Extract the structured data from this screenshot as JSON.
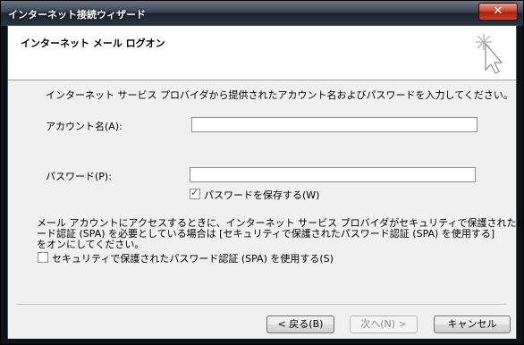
{
  "window": {
    "title": "インターネット接続ウィザード",
    "close_symbol": "✕"
  },
  "header": {
    "title": "インターネット メール ログオン",
    "graphic_icon": "wizard-star-cursor-icon"
  },
  "body": {
    "instruction": "インターネット サービス プロバイダから提供されたアカウント名およびパスワードを入力してください。",
    "account_label": "アカウント名(A):",
    "account_value": "",
    "password_label": "パスワード(P):",
    "password_value": "",
    "save_password": {
      "label": "パスワードを保存する(W)",
      "checked": true
    },
    "spa_note_line1": "メール アカウントにアクセスするときに、インターネット サービス プロバイダがセキュリティで保護されたパスワ",
    "spa_note_line2": "ード認証 (SPA) を必要としている場合は [セキュリティで保護されたパスワード認証 (SPA) を使用する]",
    "spa_note_line3": "をオンにしてください。",
    "spa_checkbox": {
      "label": "セキュリティで保護されたパスワード認証 (SPA) を使用する(S)",
      "checked": false
    }
  },
  "footer": {
    "back_label": "< 戻る(B)",
    "next_label": "次へ(N) >",
    "cancel_label": "キャンセル",
    "next_enabled": false
  }
}
